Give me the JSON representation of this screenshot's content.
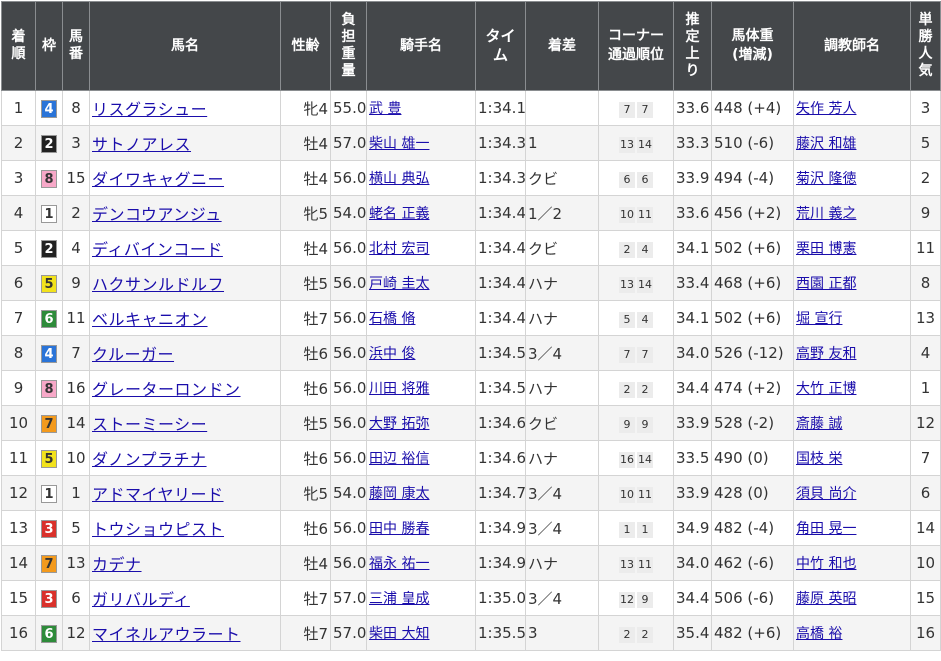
{
  "headers": [
    "着順",
    "枠",
    "馬番",
    "馬名",
    "性齢",
    "負担重量",
    "騎手名",
    "タイム",
    "着差",
    "コーナー通過順位",
    "推定上り",
    "馬体重(増減)",
    "調教師名",
    "単勝人気"
  ],
  "waku_colors": {
    "1": {
      "bg": "#ffffff",
      "fg": "#333333"
    },
    "2": {
      "bg": "#222222",
      "fg": "#ffffff"
    },
    "3": {
      "bg": "#d9312b",
      "fg": "#ffffff"
    },
    "4": {
      "bg": "#2a74d8",
      "fg": "#ffffff"
    },
    "5": {
      "bg": "#f2e21c",
      "fg": "#333333"
    },
    "6": {
      "bg": "#2e8b3a",
      "fg": "#ffffff"
    },
    "7": {
      "bg": "#f39a1d",
      "fg": "#333333"
    },
    "8": {
      "bg": "#f7a8c8",
      "fg": "#333333"
    }
  },
  "rows": [
    {
      "rank": "1",
      "waku": "4",
      "num": "8",
      "horse": "リスグラシュー",
      "sexage": "牝4",
      "weight": "55.0",
      "jockey": "武 豊",
      "time": "1:34.1",
      "margin": "",
      "corner": [
        "7",
        "7"
      ],
      "last3f": "33.6",
      "body": "448 (+4)",
      "trainer": "矢作 芳人",
      "pop": "3"
    },
    {
      "rank": "2",
      "waku": "2",
      "num": "3",
      "horse": "サトノアレス",
      "sexage": "牡4",
      "weight": "57.0",
      "jockey": "柴山 雄一",
      "time": "1:34.3",
      "margin": "1",
      "corner": [
        "13",
        "14"
      ],
      "last3f": "33.3",
      "body": "510 (-6)",
      "trainer": "藤沢 和雄",
      "pop": "5"
    },
    {
      "rank": "3",
      "waku": "8",
      "num": "15",
      "horse": "ダイワキャグニー",
      "sexage": "牡4",
      "weight": "56.0",
      "jockey": "横山 典弘",
      "time": "1:34.3",
      "margin": "クビ",
      "corner": [
        "6",
        "6"
      ],
      "last3f": "33.9",
      "body": "494 (-4)",
      "trainer": "菊沢 隆徳",
      "pop": "2"
    },
    {
      "rank": "4",
      "waku": "1",
      "num": "2",
      "horse": "デンコウアンジュ",
      "sexage": "牝5",
      "weight": "54.0",
      "jockey": "蛯名 正義",
      "time": "1:34.4",
      "margin": "1／2",
      "corner": [
        "10",
        "11"
      ],
      "last3f": "33.6",
      "body": "456 (+2)",
      "trainer": "荒川 義之",
      "pop": "9"
    },
    {
      "rank": "5",
      "waku": "2",
      "num": "4",
      "horse": "ディバインコード",
      "sexage": "牡4",
      "weight": "56.0",
      "jockey": "北村 宏司",
      "time": "1:34.4",
      "margin": "クビ",
      "corner": [
        "2",
        "4"
      ],
      "last3f": "34.1",
      "body": "502 (+6)",
      "trainer": "栗田 博憲",
      "pop": "11"
    },
    {
      "rank": "6",
      "waku": "5",
      "num": "9",
      "horse": "ハクサンルドルフ",
      "sexage": "牡5",
      "weight": "56.0",
      "jockey": "戸崎 圭太",
      "time": "1:34.4",
      "margin": "ハナ",
      "corner": [
        "13",
        "14"
      ],
      "last3f": "33.4",
      "body": "468 (+6)",
      "trainer": "西園 正都",
      "pop": "8"
    },
    {
      "rank": "7",
      "waku": "6",
      "num": "11",
      "horse": "ベルキャニオン",
      "sexage": "牡7",
      "weight": "56.0",
      "jockey": "石橋 脩",
      "time": "1:34.4",
      "margin": "ハナ",
      "corner": [
        "5",
        "4"
      ],
      "last3f": "34.1",
      "body": "502 (+6)",
      "trainer": "堀 宣行",
      "pop": "13"
    },
    {
      "rank": "8",
      "waku": "4",
      "num": "7",
      "horse": "クルーガー",
      "sexage": "牡6",
      "weight": "56.0",
      "jockey": "浜中 俊",
      "time": "1:34.5",
      "margin": "3／4",
      "corner": [
        "7",
        "7"
      ],
      "last3f": "34.0",
      "body": "526 (-12)",
      "trainer": "高野 友和",
      "pop": "4"
    },
    {
      "rank": "9",
      "waku": "8",
      "num": "16",
      "horse": "グレーターロンドン",
      "sexage": "牡6",
      "weight": "56.0",
      "jockey": "川田 将雅",
      "time": "1:34.5",
      "margin": "ハナ",
      "corner": [
        "2",
        "2"
      ],
      "last3f": "34.4",
      "body": "474 (+2)",
      "trainer": "大竹 正博",
      "pop": "1"
    },
    {
      "rank": "10",
      "waku": "7",
      "num": "14",
      "horse": "ストーミーシー",
      "sexage": "牡5",
      "weight": "56.0",
      "jockey": "大野 拓弥",
      "time": "1:34.6",
      "margin": "クビ",
      "corner": [
        "9",
        "9"
      ],
      "last3f": "33.9",
      "body": "528 (-2)",
      "trainer": "斎藤 誠",
      "pop": "12"
    },
    {
      "rank": "11",
      "waku": "5",
      "num": "10",
      "horse": "ダノンプラチナ",
      "sexage": "牡6",
      "weight": "56.0",
      "jockey": "田辺 裕信",
      "time": "1:34.6",
      "margin": "ハナ",
      "corner": [
        "16",
        "14"
      ],
      "last3f": "33.5",
      "body": "490 (0)",
      "trainer": "国枝 栄",
      "pop": "7"
    },
    {
      "rank": "12",
      "waku": "1",
      "num": "1",
      "horse": "アドマイヤリード",
      "sexage": "牝5",
      "weight": "54.0",
      "jockey": "藤岡 康太",
      "time": "1:34.7",
      "margin": "3／4",
      "corner": [
        "10",
        "11"
      ],
      "last3f": "33.9",
      "body": "428 (0)",
      "trainer": "須貝 尚介",
      "pop": "6"
    },
    {
      "rank": "13",
      "waku": "3",
      "num": "5",
      "horse": "トウショウピスト",
      "sexage": "牡6",
      "weight": "56.0",
      "jockey": "田中 勝春",
      "time": "1:34.9",
      "margin": "3／4",
      "corner": [
        "1",
        "1"
      ],
      "last3f": "34.9",
      "body": "482 (-4)",
      "trainer": "角田 晃一",
      "pop": "14"
    },
    {
      "rank": "14",
      "waku": "7",
      "num": "13",
      "horse": "カデナ",
      "sexage": "牡4",
      "weight": "56.0",
      "jockey": "福永 祐一",
      "time": "1:34.9",
      "margin": "ハナ",
      "corner": [
        "13",
        "11"
      ],
      "last3f": "34.0",
      "body": "462 (-6)",
      "trainer": "中竹 和也",
      "pop": "10"
    },
    {
      "rank": "15",
      "waku": "3",
      "num": "6",
      "horse": "ガリバルディ",
      "sexage": "牡7",
      "weight": "57.0",
      "jockey": "三浦 皇成",
      "time": "1:35.0",
      "margin": "3／4",
      "corner": [
        "12",
        "9"
      ],
      "last3f": "34.4",
      "body": "506 (-6)",
      "trainer": "藤原 英昭",
      "pop": "15"
    },
    {
      "rank": "16",
      "waku": "6",
      "num": "12",
      "horse": "マイネルアウラート",
      "sexage": "牡7",
      "weight": "57.0",
      "jockey": "柴田 大知",
      "time": "1:35.5",
      "margin": "3",
      "corner": [
        "2",
        "2"
      ],
      "last3f": "35.4",
      "body": "482 (+6)",
      "trainer": "高橋 裕",
      "pop": "16"
    }
  ]
}
